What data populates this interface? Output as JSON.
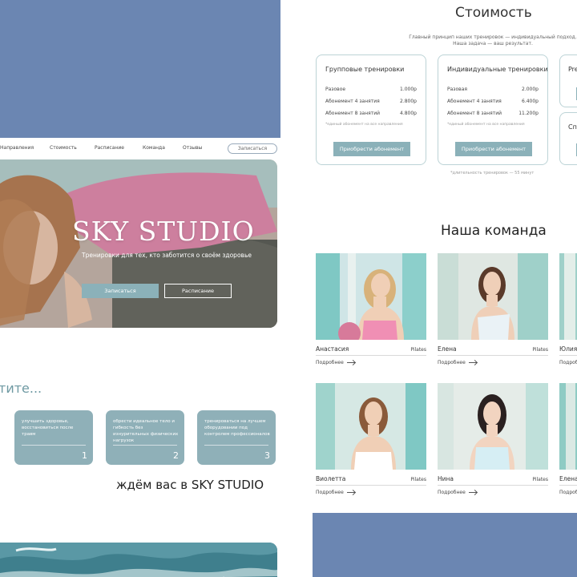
{
  "pricing": {
    "title": "Стоимость",
    "subtitle_line1": "Главный принцип наших тренировок — индивидуальный подход.",
    "subtitle_line2": "Наша задача — ваш результат.",
    "cards": [
      {
        "title": "Групповые тренировки",
        "rows": [
          {
            "label": "Разовое",
            "price": "1.000р"
          },
          {
            "label": "Абонемент 4 занятия",
            "price": "2.800р"
          },
          {
            "label": "Абонемент 8 занятий",
            "price": "4.800р"
          }
        ],
        "note": "*единый абонемент на все направления",
        "button": "Приобрести абонемент"
      },
      {
        "title": "Индивидуальные тренировки",
        "rows": [
          {
            "label": "Разовая",
            "price": "2.000р"
          },
          {
            "label": "Абонемент 4 занятия",
            "price": "6.400р"
          },
          {
            "label": "Абонемент 8 занятий",
            "price": "11.200р"
          }
        ],
        "note": "*единый абонемент на все направления",
        "button": "Приобрести абонемент"
      }
    ],
    "partial_cards": [
      "Pre",
      "Сп"
    ],
    "duration_note": "*длительность тренировок — 55 минут"
  },
  "team": {
    "title": "Наша команда",
    "more_label": "Подробнее",
    "members": [
      {
        "name": "Анастасия",
        "role": "Pilates"
      },
      {
        "name": "Елена",
        "role": "Pilates"
      },
      {
        "name": "Юлия",
        "role": ""
      },
      {
        "name": "Виолетта",
        "role": "Pilates"
      },
      {
        "name": "Нина",
        "role": "Pilates"
      },
      {
        "name": "Елена",
        "role": ""
      }
    ]
  },
  "nav": {
    "items": [
      "Направления",
      "Стоимость",
      "Расписание",
      "Команда",
      "Отзывы"
    ],
    "signup": "Записаться"
  },
  "hero": {
    "title": "SKY STUDIO",
    "subtitle": "Тренировки для тех, кто заботится о своём здоровье",
    "primary_button": "Записаться",
    "secondary_button": "Расписание"
  },
  "benefits": {
    "heading": "тите...",
    "items": [
      {
        "text": "улучшить здоровье, восстановиться после травм",
        "number": "1"
      },
      {
        "text": "обрести идеальное тело и гибкость без изнурительных физических нагрузок",
        "number": "2"
      },
      {
        "text": "тренироваться на лучшем оборудовании под контролем профессионалов",
        "number": "3"
      }
    ],
    "closing": "ждём вас в SKY STUDIO"
  },
  "colors": {
    "background": "#6b86b2",
    "accent": "#8bb1b9",
    "benefit_card": "#8fb0b8",
    "heading_accent": "#6f9aa3"
  }
}
